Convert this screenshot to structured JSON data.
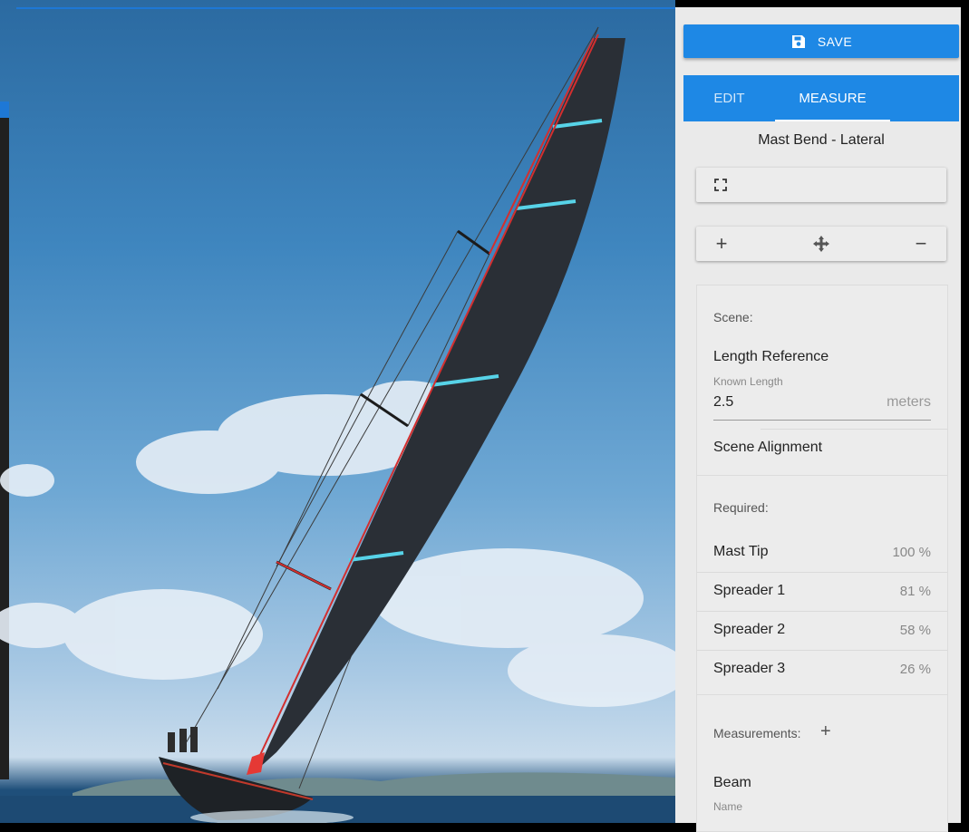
{
  "toolbar": {
    "save_label": "SAVE"
  },
  "tabs": [
    {
      "label": "EDIT"
    },
    {
      "label": "MEASURE"
    }
  ],
  "scene_name": "Mast Bend - Lateral",
  "scene": {
    "label": "Scene:",
    "length_reference": "Length Reference",
    "known_length_label": "Known Length",
    "known_length_value": "2.5",
    "known_length_unit": "meters",
    "scene_alignment": "Scene Alignment"
  },
  "required": {
    "label": "Required:",
    "items": [
      {
        "name": "Mast Tip",
        "value": "100 %"
      },
      {
        "name": "Spreader 1",
        "value": "81 %"
      },
      {
        "name": "Spreader 2",
        "value": "58 %"
      },
      {
        "name": "Spreader 3",
        "value": "26 %"
      }
    ]
  },
  "measurements": {
    "label": "Measurements:",
    "items": [
      {
        "title": "Beam",
        "name_label": "Name"
      }
    ]
  },
  "icons": {
    "save": "floppy-disk-icon",
    "fullscreen": "fullscreen-icon",
    "zoom_in": "plus-icon",
    "pan": "move-arrows-icon",
    "zoom_out": "minus-icon",
    "add_measurement": "plus-icon"
  }
}
